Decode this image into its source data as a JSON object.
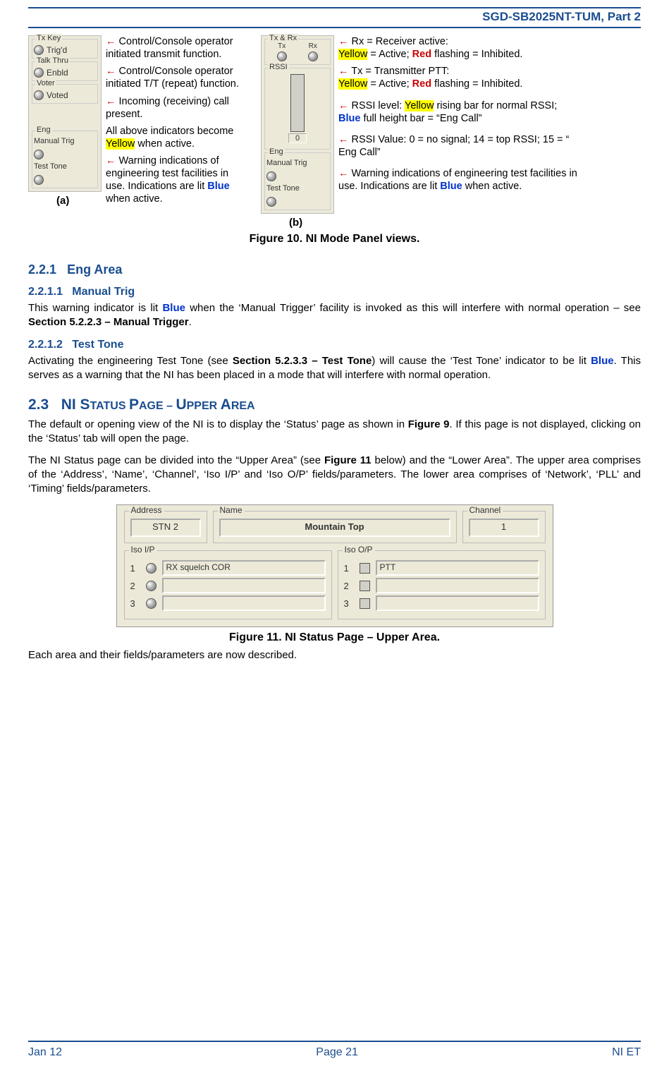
{
  "header": "SGD-SB2025NT-TUM, Part 2",
  "footer": {
    "left": "Jan 12",
    "center": "Page 21",
    "right": "NI ET"
  },
  "fig10": {
    "panelA": {
      "groups": {
        "txkey": {
          "title": "Tx Key",
          "label": "Trig'd"
        },
        "talk": {
          "title": "Talk Thru",
          "label": "Enbld"
        },
        "voter": {
          "title": "Voter",
          "label": "Voted"
        },
        "eng": {
          "title": "Eng",
          "rows": [
            "Manual Trig",
            "Test Tone"
          ]
        }
      },
      "label": "(a)"
    },
    "panelB": {
      "groups": {
        "txrx": {
          "title": "Tx & Rx",
          "tx": "Tx",
          "rx": "Rx"
        },
        "rssi": {
          "title": "RSSI",
          "value": "0"
        },
        "eng": {
          "title": "Eng",
          "rows": [
            "Manual Trig",
            "Test Tone"
          ]
        }
      },
      "label": "(b)"
    },
    "annA": {
      "a1": "Control/Console operator initiated transmit function.",
      "a2": "Control/Console operator initiated T/T (repeat)  function.",
      "a3": "Incoming (receiving) call present.",
      "a4_pre": "All above indicators become ",
      "a4_hl": "Yellow",
      "a4_post": " when active.",
      "a5_pre": "Warning indications of engineering test facilities in use.  Indications are lit ",
      "a5_blue": "Blue",
      "a5_post": " when active."
    },
    "annB": {
      "b1_pre": "Rx = Receiver active:",
      "b1_y": "Yellow",
      "b1_mid": " = Active; ",
      "b1_r": "Red",
      "b1_post": " flashing = Inhibited.",
      "b2_pre": "Tx = Transmitter PTT:",
      "b2_y": "Yellow",
      "b2_mid": " = Active; ",
      "b2_r": "Red",
      "b2_post": " flashing = Inhibited.",
      "b3_pre": "RSSI level: ",
      "b3_y": "Yellow",
      "b3_mid": " rising bar for normal RSSI; ",
      "b3_b": "Blue",
      "b3_post": " full height bar = “Eng Call”",
      "b4": "RSSI Value: 0 = no signal; 14 = top RSSI; 15 = “ Eng Call”",
      "b5_pre": "Warning indications of engineering test facilities in use.  Indications are lit ",
      "b5_b": "Blue",
      "b5_post": " when active."
    },
    "caption": "Figure 10.  NI Mode Panel views."
  },
  "sections": {
    "s221_num": "2.2.1",
    "s221_title": "Eng Area",
    "s2211_num": "2.2.1.1",
    "s2211_title": "Manual Trig",
    "p2211_pre": "This warning indicator is lit ",
    "p2211_b": "Blue",
    "p2211_mid": " when the ‘Manual Trigger’ facility is invoked as this will interfere with normal operation – see ",
    "p2211_bold": "Section 5.2.2.3 – Manual Trigger",
    "p2211_post": ".",
    "s2212_num": "2.2.1.2",
    "s2212_title": "Test Tone",
    "p2212_pre": "Activating the engineering Test Tone (see ",
    "p2212_bold": "Section 5.2.3.3 – Test Tone",
    "p2212_mid": ") will cause the ‘Test Tone’ indicator to be lit ",
    "p2212_b": "Blue",
    "p2212_post": ".  This serves as a warning that the NI has been placed in a mode that will interfere with normal operation.",
    "s23_num": "2.3",
    "s23_title_a": "NI S",
    "s23_title_b": "TATUS ",
    "s23_title_c": "P",
    "s23_title_d": "AGE – ",
    "s23_title_e": "U",
    "s23_title_f": "PPER ",
    "s23_title_g": "A",
    "s23_title_h": "REA",
    "p23a_pre": "The default or opening view of the NI is to display the ‘Status’ page as shown in ",
    "p23a_bold": "Figure 9",
    "p23a_post": ".  If this page is not displayed, clicking on the ‘Status’ tab will open the page.",
    "p23b_pre": "The NI Status page can be divided into the “Upper Area” (see ",
    "p23b_bold": "Figure 11",
    "p23b_post": " below) and the “Lower Area”.   The upper area comprises of the ‘Address’, ‘Name’, ‘Channel’, ‘Iso I/P’ and ‘Iso O/P’ fields/parameters.  The lower area comprises of ‘Network’, ‘PLL’ and ‘Timing’ fields/parameters."
  },
  "fig11": {
    "address": {
      "legend": "Address",
      "value": "STN 2"
    },
    "name": {
      "legend": "Name",
      "value": "Mountain Top"
    },
    "channel": {
      "legend": "Channel",
      "value": "1"
    },
    "isoip": {
      "legend": "Iso I/P",
      "rows": [
        {
          "n": "1",
          "label": "RX squelch COR"
        },
        {
          "n": "2",
          "label": ""
        },
        {
          "n": "3",
          "label": ""
        }
      ]
    },
    "isoop": {
      "legend": "Iso O/P",
      "rows": [
        {
          "n": "1",
          "label": "PTT"
        },
        {
          "n": "2",
          "label": ""
        },
        {
          "n": "3",
          "label": ""
        }
      ]
    },
    "caption": "Figure 11.  NI Status Page – Upper Area."
  },
  "closing": "Each area and their fields/parameters are now described."
}
